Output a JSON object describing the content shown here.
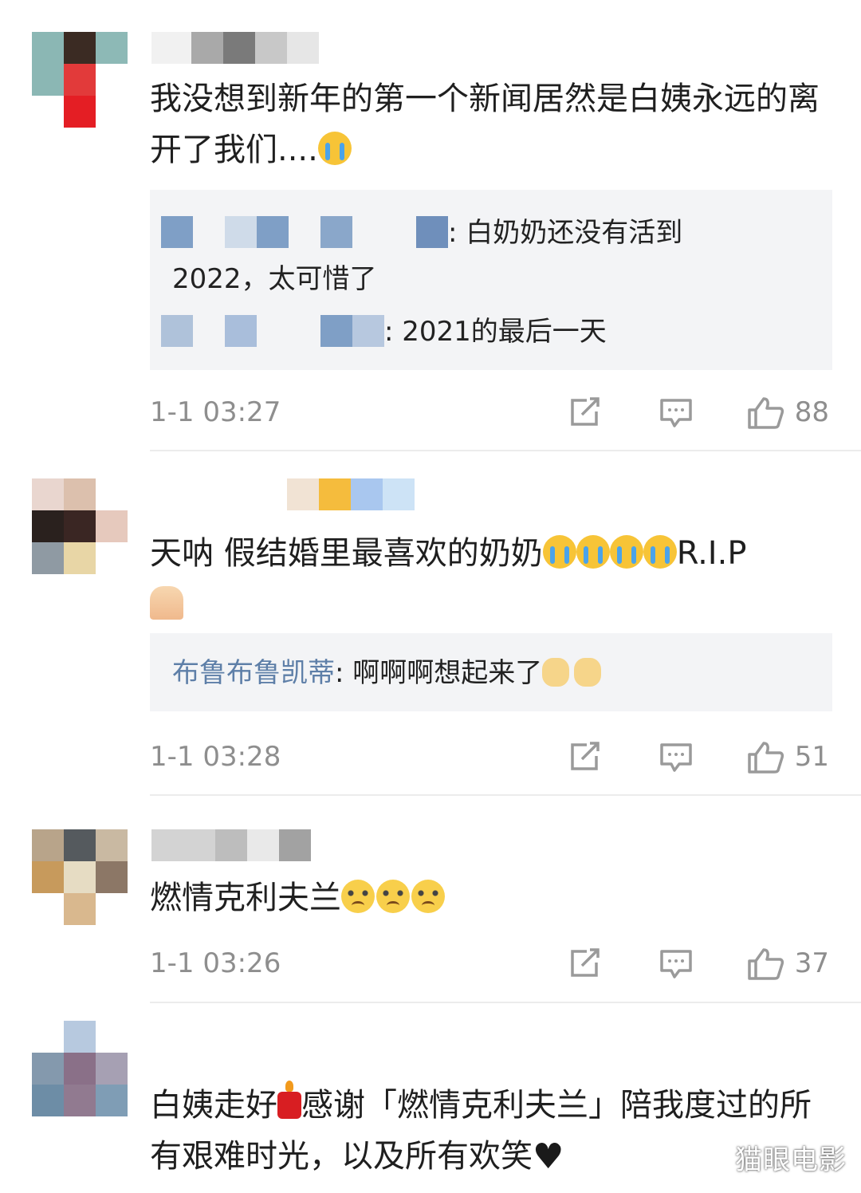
{
  "comments": [
    {
      "text": "我没想到新年的第一个新闻居然是白姨永远的离开了我们....",
      "replies": [
        {
          "text": ": 白奶奶还没有活到"
        },
        {
          "text": "2022，太可惜了"
        },
        {
          "text": ": 2021的最后一天"
        }
      ],
      "time": "1-1 03:27",
      "likes": "88"
    },
    {
      "text": "天呐 假结婚里最喜欢的奶奶",
      "text_tail": "R.I.P",
      "replies": [
        {
          "name": "布鲁布鲁凯蒂",
          "text": ": 啊啊啊想起来了"
        }
      ],
      "time": "1-1 03:28",
      "likes": "51"
    },
    {
      "text": "燃情克利夫兰",
      "time": "1-1 03:26",
      "likes": "37"
    },
    {
      "text_a": "白姨走好",
      "text_b": "感谢「燃情克利夫兰」陪我度过的所有艰难时光，以及所有欢笑"
    }
  ],
  "icons": {
    "share": "share-icon",
    "comment": "comment-icon",
    "like": "thumbs-up-icon",
    "emoji_cry": "loudly-crying-face",
    "emoji_sad": "pleading-face",
    "emoji_dog": "crying-dog-face",
    "emoji_pray": "folded-hands",
    "emoji_candle": "candle",
    "emoji_heart": "black-heart"
  },
  "colors": {
    "reply_name": "#5e7fa8",
    "meta_gray": "#8e8e8e",
    "reply_bg": "#f3f4f6"
  },
  "watermark": "猫眼电影"
}
